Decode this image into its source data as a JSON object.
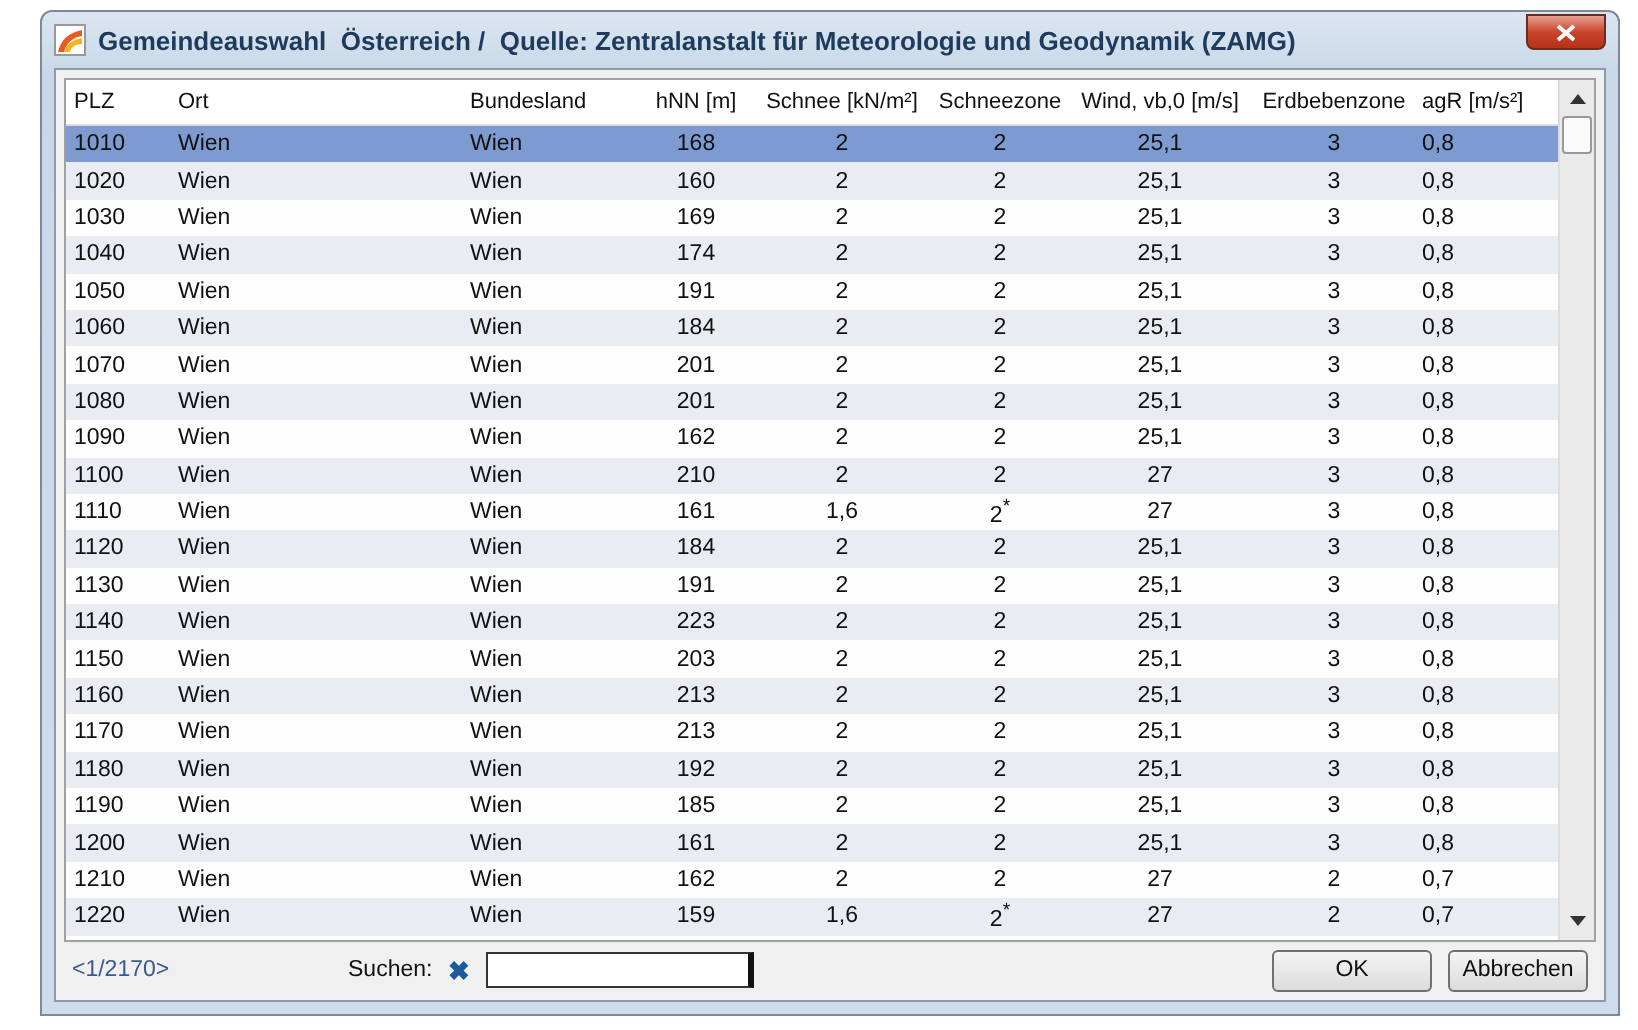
{
  "window": {
    "title": "Gemeindeauswahl  Österreich /  Quelle: Zentralanstalt für Meteorologie und Geodynamik (ZAMG)"
  },
  "table": {
    "columns": [
      "PLZ",
      "Ort",
      "Bundesland",
      "hNN  [m]",
      "Schnee [kN/m²]",
      "Schneezone",
      "Wind, vb,0 [m/s]",
      "Erdbebenzone",
      "agR  [m/s²]"
    ],
    "rows": [
      {
        "selected": true,
        "cells": [
          "1010",
          "Wien",
          "Wien",
          "168",
          "2",
          "2",
          "25,1",
          "3",
          "0,8"
        ]
      },
      {
        "selected": false,
        "cells": [
          "1020",
          "Wien",
          "Wien",
          "160",
          "2",
          "2",
          "25,1",
          "3",
          "0,8"
        ]
      },
      {
        "selected": false,
        "cells": [
          "1030",
          "Wien",
          "Wien",
          "169",
          "2",
          "2",
          "25,1",
          "3",
          "0,8"
        ]
      },
      {
        "selected": false,
        "cells": [
          "1040",
          "Wien",
          "Wien",
          "174",
          "2",
          "2",
          "25,1",
          "3",
          "0,8"
        ]
      },
      {
        "selected": false,
        "cells": [
          "1050",
          "Wien",
          "Wien",
          "191",
          "2",
          "2",
          "25,1",
          "3",
          "0,8"
        ]
      },
      {
        "selected": false,
        "cells": [
          "1060",
          "Wien",
          "Wien",
          "184",
          "2",
          "2",
          "25,1",
          "3",
          "0,8"
        ]
      },
      {
        "selected": false,
        "cells": [
          "1070",
          "Wien",
          "Wien",
          "201",
          "2",
          "2",
          "25,1",
          "3",
          "0,8"
        ]
      },
      {
        "selected": false,
        "cells": [
          "1080",
          "Wien",
          "Wien",
          "201",
          "2",
          "2",
          "25,1",
          "3",
          "0,8"
        ]
      },
      {
        "selected": false,
        "cells": [
          "1090",
          "Wien",
          "Wien",
          "162",
          "2",
          "2",
          "25,1",
          "3",
          "0,8"
        ]
      },
      {
        "selected": false,
        "cells": [
          "1100",
          "Wien",
          "Wien",
          "210",
          "2",
          "2",
          "27",
          "3",
          "0,8"
        ]
      },
      {
        "selected": false,
        "cells": [
          "1110",
          "Wien",
          "Wien",
          "161",
          "1,6",
          "2$^{*}$",
          "27",
          "3",
          "0,8"
        ]
      },
      {
        "selected": false,
        "cells": [
          "1120",
          "Wien",
          "Wien",
          "184",
          "2",
          "2",
          "25,1",
          "3",
          "0,8"
        ]
      },
      {
        "selected": false,
        "cells": [
          "1130",
          "Wien",
          "Wien",
          "191",
          "2",
          "2",
          "25,1",
          "3",
          "0,8"
        ]
      },
      {
        "selected": false,
        "cells": [
          "1140",
          "Wien",
          "Wien",
          "223",
          "2",
          "2",
          "25,1",
          "3",
          "0,8"
        ]
      },
      {
        "selected": false,
        "cells": [
          "1150",
          "Wien",
          "Wien",
          "203",
          "2",
          "2",
          "25,1",
          "3",
          "0,8"
        ]
      },
      {
        "selected": false,
        "cells": [
          "1160",
          "Wien",
          "Wien",
          "213",
          "2",
          "2",
          "25,1",
          "3",
          "0,8"
        ]
      },
      {
        "selected": false,
        "cells": [
          "1170",
          "Wien",
          "Wien",
          "213",
          "2",
          "2",
          "25,1",
          "3",
          "0,8"
        ]
      },
      {
        "selected": false,
        "cells": [
          "1180",
          "Wien",
          "Wien",
          "192",
          "2",
          "2",
          "25,1",
          "3",
          "0,8"
        ]
      },
      {
        "selected": false,
        "cells": [
          "1190",
          "Wien",
          "Wien",
          "185",
          "2",
          "2",
          "25,1",
          "3",
          "0,8"
        ]
      },
      {
        "selected": false,
        "cells": [
          "1200",
          "Wien",
          "Wien",
          "161",
          "2",
          "2",
          "25,1",
          "3",
          "0,8"
        ]
      },
      {
        "selected": false,
        "cells": [
          "1210",
          "Wien",
          "Wien",
          "162",
          "2",
          "2",
          "27",
          "2",
          "0,7"
        ]
      },
      {
        "selected": false,
        "cells": [
          "1220",
          "Wien",
          "Wien",
          "159",
          "1,6",
          "2$^{*}$",
          "27",
          "2",
          "0,7"
        ]
      }
    ]
  },
  "footer": {
    "pager": "<1/2170>",
    "search_label": "Suchen:",
    "clear_icon": "✖",
    "buttons": [
      "OK",
      "Abbrechen"
    ]
  }
}
